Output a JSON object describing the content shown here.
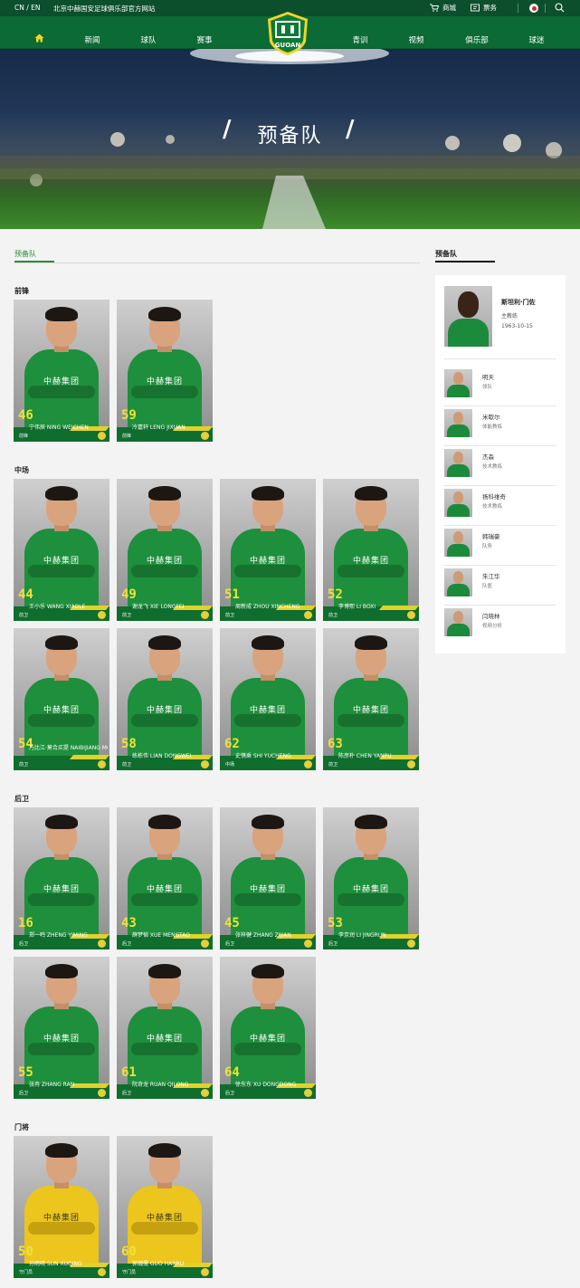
{
  "topbar": {
    "lang": "CN / EN",
    "site_name": "北京中赫国安足球俱乐部官方网站",
    "shop": "商城",
    "service": "票务"
  },
  "nav": {
    "left": [
      "新闻",
      "球队",
      "赛事"
    ],
    "right": [
      "青训",
      "视频",
      "俱乐部",
      "球迷"
    ]
  },
  "logo": {
    "text": "GUOAN"
  },
  "banner": {
    "title": "预备队"
  },
  "tab": {
    "label": "预备队"
  },
  "sections": [
    {
      "title": "前锋",
      "players": [
        {
          "number": "46",
          "name": "宁伟辰  NING WEICHEN",
          "position": "前锋"
        },
        {
          "number": "59",
          "name": "冷嘉轩  LENG JIXUAN",
          "position": "前锋"
        }
      ]
    },
    {
      "title": "中场",
      "players": [
        {
          "number": "44",
          "name": "王小乐  WANG XIAOLE",
          "position": "前卫"
        },
        {
          "number": "49",
          "name": "谢龙飞  XIE LONGFEI",
          "position": "前卫"
        },
        {
          "number": "51",
          "name": "周新成  ZHOU XINCHENG",
          "position": "前卫"
        },
        {
          "number": "52",
          "name": "李博熙  LI BOXI",
          "position": "前卫"
        },
        {
          "number": "54",
          "name": "乃比江·莫合买提  NAIBIJIANG MOHEMAITI",
          "position": "前卫"
        },
        {
          "number": "58",
          "name": "练栋伟  LIAN DONGWEI",
          "position": "前卫"
        },
        {
          "number": "62",
          "name": "史镌乘  SHI YUCHENG",
          "position": "中场"
        },
        {
          "number": "63",
          "name": "陈彦朴  CHEN YANPU",
          "position": "前卫"
        }
      ]
    },
    {
      "title": "后卫",
      "players": [
        {
          "number": "16",
          "name": "郑一鸣  ZHENG YIMING",
          "position": "后卫"
        },
        {
          "number": "43",
          "name": "薛梦韬  XUE MENGTAO",
          "position": "后卫"
        },
        {
          "number": "45",
          "name": "张梓健  ZHANG ZIJIAN",
          "position": "后卫"
        },
        {
          "number": "53",
          "name": "李京润  LI JINGRUN",
          "position": "后卫"
        },
        {
          "number": "55",
          "name": "张冉  ZHANG RAN",
          "position": "后卫"
        },
        {
          "number": "61",
          "name": "阮奇龙  RUAN QILONG",
          "position": "后卫"
        },
        {
          "number": "64",
          "name": "徐东东  XU DONGDONG",
          "position": "后卫"
        }
      ]
    },
    {
      "title": "门将",
      "players": [
        {
          "number": "50",
          "name": "孙雨晴  SUN XUQING",
          "position": "守门员"
        },
        {
          "number": "60",
          "name": "郭瀚儒  GUO HANRU",
          "position": "守门员"
        }
      ]
    }
  ],
  "sidebar": {
    "title": "预备队",
    "head_coach": {
      "name": "斯坦利·门佐",
      "role": "主教练",
      "birth": "1963-10-15"
    },
    "staff": [
      {
        "name": "明天",
        "role": "领队"
      },
      {
        "name": "米歇尔",
        "role": "体能教练"
      },
      {
        "name": "杰森",
        "role": "技术教练"
      },
      {
        "name": "扬科维奇",
        "role": "技术教练"
      },
      {
        "name": "韩瑞豪",
        "role": "队务"
      },
      {
        "name": "朱江华",
        "role": "队医"
      },
      {
        "name": "闫晓林",
        "role": "视频分析"
      }
    ]
  }
}
